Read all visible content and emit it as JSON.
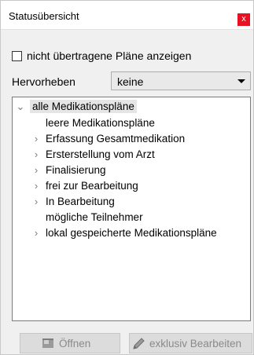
{
  "window": {
    "title": "Statusübersicht",
    "close_label": "x"
  },
  "filter": {
    "checkbox_label": "nicht übertragene Pläne anzeigen",
    "checkbox_checked": false
  },
  "highlight": {
    "label": "Hervorheben",
    "selected": "keine"
  },
  "tree": {
    "root": {
      "label": "alle Medikationspläne",
      "expanded": true
    },
    "children": [
      {
        "label": "leere Medikationspläne",
        "expandable": false
      },
      {
        "label": "Erfassung Gesamtmedikation",
        "expandable": true
      },
      {
        "label": "Ersterstellung vom Arzt",
        "expandable": true
      },
      {
        "label": "Finalisierung",
        "expandable": true
      },
      {
        "label": "frei zur Bearbeitung",
        "expandable": true
      },
      {
        "label": "In Bearbeitung",
        "expandable": true
      },
      {
        "label": "mögliche Teilnehmer",
        "expandable": false
      },
      {
        "label": "lokal gespeicherte Medikationspläne",
        "expandable": true
      }
    ]
  },
  "buttons": {
    "open_label": "Öffnen",
    "edit_label": "exklusiv Bearbeiten",
    "enabled": false
  }
}
